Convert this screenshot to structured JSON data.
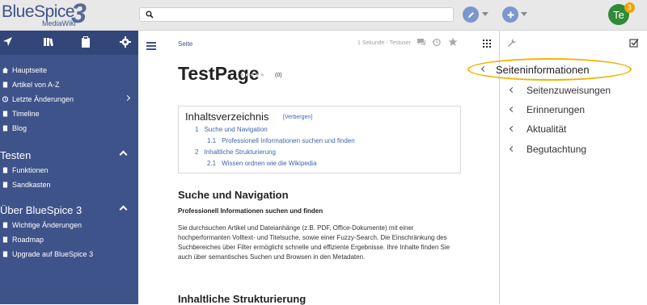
{
  "brand": {
    "name": "BlueSpice",
    "version": "3",
    "subtitle": "MediaWiki"
  },
  "search": {
    "placeholder": ""
  },
  "user": {
    "initials": "Te",
    "notifications": "3"
  },
  "sidebar": {
    "items_main": [
      {
        "label": "Hauptseite",
        "icon": "home-icon"
      },
      {
        "label": "Artikel von A-Z",
        "icon": "document-icon"
      },
      {
        "label": "Letzte Änderungen",
        "icon": "clock-icon"
      },
      {
        "label": "Timeline",
        "icon": "document-icon"
      },
      {
        "label": "Blog",
        "icon": "document-icon"
      }
    ],
    "section_testen": "Testen",
    "items_testen": [
      {
        "label": "Funktionen",
        "icon": "document-icon"
      },
      {
        "label": "Sandkasten",
        "icon": "document-icon"
      }
    ],
    "section_ueber": "Über BlueSpice 3",
    "items_ueber": [
      {
        "label": "Wichtige Änderungen",
        "icon": "document-icon"
      },
      {
        "label": "Roadmap",
        "icon": "document-icon"
      },
      {
        "label": "Upgrade auf BlueSpice 3",
        "icon": "document-icon"
      }
    ]
  },
  "page": {
    "tab_label": "Seite",
    "edit_info": "1 Sekunde - Testuser",
    "title": "TestPage",
    "stars": "★★★★★",
    "rating_count": "(0)"
  },
  "toc": {
    "title": "Inhaltsverzeichnis",
    "toggle": "[Verbergen]",
    "entries": [
      {
        "num": "1",
        "text": "Suche und Navigation"
      },
      {
        "num": "1.1",
        "text": "Professionell Informationen suchen und finden"
      },
      {
        "num": "2",
        "text": "Inhaltliche Strukturierung"
      },
      {
        "num": "2.1",
        "text": "Wissen ordnen wie die Wikipedia"
      }
    ]
  },
  "content": {
    "h2_1": "Suche und Navigation",
    "h3_1": "Professionell Informationen suchen und finden",
    "para_1": "Sie durchsuchen Artikel und Dateianhänge (z.B. PDF, Office-Dokumente) mit einer hochperformanten Volltext- und Titelsuche, sowie einer Fuzzy-Search. Die Einschränkung des Suchbereiches über Filter ermöglicht schnelle und effiziente Ergebnisse. Ihre Inhalte finden Sie auch über semantisches Suchen und Browsen in den Metadaten.",
    "h2_2": "Inhaltliche Strukturierung"
  },
  "right_panel": {
    "items": [
      {
        "label": "Seiteninformationen",
        "active": true
      },
      {
        "label": "Seitenzuweisungen"
      },
      {
        "label": "Erinnerungen"
      },
      {
        "label": "Aktualität"
      },
      {
        "label": "Begutachtung"
      }
    ]
  },
  "colors": {
    "brand": "#3e5389",
    "link": "#3e66b0",
    "highlight": "#f0b400"
  }
}
